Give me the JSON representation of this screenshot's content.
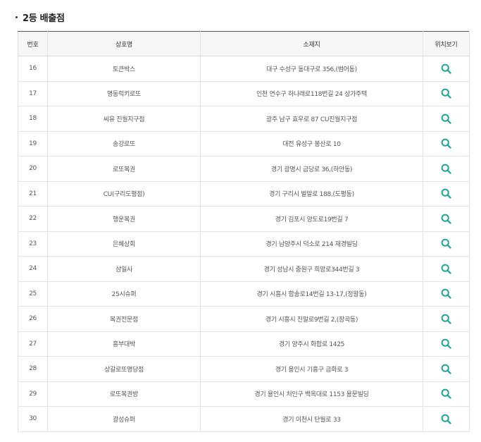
{
  "section": {
    "title": "2등 배출점"
  },
  "table": {
    "headers": {
      "number": "번호",
      "name": "상호명",
      "address": "소재지",
      "map": "위치보기"
    },
    "rows": [
      {
        "number": "16",
        "name": "토큰박스",
        "address": "대구 수성구 동대구로 356,(범어동)"
      },
      {
        "number": "17",
        "name": "명동럭키로또",
        "address": "인천 연수구 하나래로118번길 24 상가주택"
      },
      {
        "number": "18",
        "name": "씨유 진월지구점",
        "address": "광주 남구 효우로 87 CU진월지구점"
      },
      {
        "number": "19",
        "name": "송강로또",
        "address": "대전 유성구 봉산로 10"
      },
      {
        "number": "20",
        "name": "로또복권",
        "address": "경기 광명시 금당로 36,(하안동)"
      },
      {
        "number": "21",
        "name": "CU(구리도평점)",
        "address": "경기 구리시 벌말로 188,(도평동)"
      },
      {
        "number": "22",
        "name": "행운복권",
        "address": "경기 김포시 양도로19번길 7"
      },
      {
        "number": "23",
        "name": "은혜상회",
        "address": "경기 남양주시 덕소로 214 재경빌딩"
      },
      {
        "number": "24",
        "name": "삼일사",
        "address": "경기 성남시 중원구 희망로344번길 3"
      },
      {
        "number": "25",
        "name": "25시슈퍼",
        "address": "경기 시흥시 함송로14번길 13-17,(정왕동)"
      },
      {
        "number": "26",
        "name": "복권전문점",
        "address": "경기 시흥시 진말로9번길 2,(장곡동)"
      },
      {
        "number": "27",
        "name": "흥부대박",
        "address": "경기 양주시 화합로 1425"
      },
      {
        "number": "28",
        "name": "상갈로또명당점",
        "address": "경기 용인시 기흥구 금화로 3"
      },
      {
        "number": "29",
        "name": "로또복권방",
        "address": "경기 용인시 처인구 백옥대로 1153 용문빌딩"
      },
      {
        "number": "30",
        "name": "광성슈퍼",
        "address": "경기 이천시 단월로 33"
      }
    ]
  },
  "icons": {
    "map_search": "search-icon"
  },
  "colors": {
    "icon": "#1aa594",
    "header_bg": "#f7f7f7",
    "header_top_border": "#555555",
    "cell_border": "#e3e3e3",
    "text": "#555555",
    "title": "#222222"
  }
}
